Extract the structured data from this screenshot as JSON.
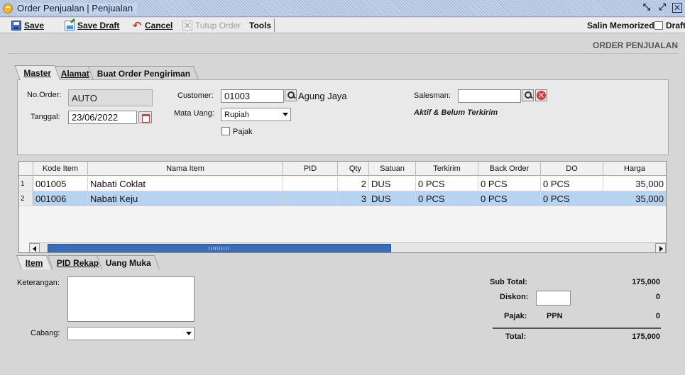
{
  "window": {
    "title": "Order Penjualan | Penjualan"
  },
  "toolbar": {
    "save_label": "Save",
    "save_draft_label": "Save Draft",
    "cancel_label": "Cancel",
    "close_order_label": "Tutup Order",
    "tools_label": "Tools",
    "salin_memorized_label": "Salin Memorized",
    "draft_label": "Draft"
  },
  "page": {
    "heading": "ORDER PENJUALAN"
  },
  "tabs_top": [
    "Master",
    "Alamat",
    "Buat Order Pengiriman"
  ],
  "master": {
    "no_order_label": "No.Order:",
    "no_order_value": "AUTO",
    "tanggal_label": "Tanggal:",
    "tanggal_value": "23/06/2022",
    "customer_label": "Customer:",
    "customer_code": "01003",
    "customer_name": "Agung Jaya",
    "mata_uang_label": "Mata Uang:",
    "mata_uang_value": "Rupiah",
    "pajak_label": "Pajak",
    "salesman_label": "Salesman:",
    "salesman_value": "",
    "status": "Aktif & Belum Terkirim"
  },
  "grid": {
    "columns": [
      "",
      "Kode Item",
      "Nama Item",
      "PID",
      "Qty",
      "Satuan",
      "Terkirim",
      "Back Order",
      "DO",
      "Harga"
    ],
    "rows": [
      {
        "num": "1",
        "kode": "001005",
        "nama": "Nabati Coklat",
        "pid": "",
        "qty": "2",
        "satuan": "DUS",
        "terkirim": "0 PCS",
        "back_order": "0 PCS",
        "do": "0 PCS",
        "harga": "35,000"
      },
      {
        "num": "2",
        "kode": "001006",
        "nama": "Nabati Keju",
        "pid": "",
        "qty": "3",
        "satuan": "DUS",
        "terkirim": "0 PCS",
        "back_order": "0 PCS",
        "do": "0 PCS",
        "harga": "35,000"
      }
    ]
  },
  "tabs_bottom": [
    "Item",
    "PID Rekap",
    "Uang Muka"
  ],
  "footer": {
    "keterangan_label": "Keterangan:",
    "cabang_label": "Cabang:",
    "cabang_value": "",
    "sub_total_label": "Sub Total:",
    "sub_total_value": "175,000",
    "diskon_label": "Diskon:",
    "diskon_input": "",
    "diskon_value": "0",
    "pajak_label": "Pajak:",
    "pajak_type": "PPN",
    "pajak_value": "0",
    "total_label": "Total:",
    "total_value": "175,000"
  }
}
